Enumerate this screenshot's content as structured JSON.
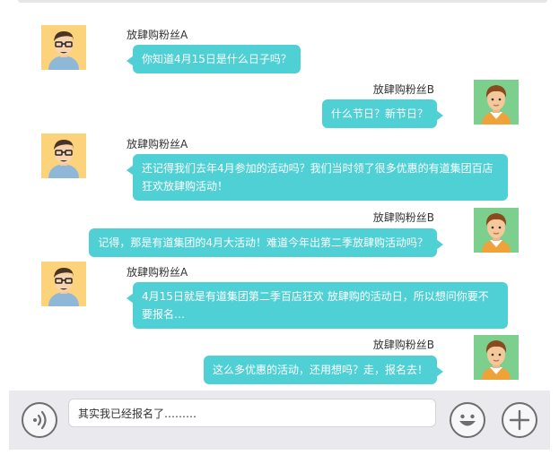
{
  "conversation": {
    "messages": [
      {
        "sender": "放肆购粉丝A",
        "text": "你知道4月15日是什么日子吗？"
      },
      {
        "sender": "放肆购粉丝B",
        "text": "什么节日？新节日？"
      },
      {
        "sender": "放肆购粉丝A",
        "text": "还记得我们去年4月参加的活动吗？我们当时领了很多优惠的有道集团百店狂欢放肆购活动！"
      },
      {
        "sender": "放肆购粉丝B",
        "text": "记得，那是有道集团的4月大活动！难道今年出第二季放肆购活动吗？"
      },
      {
        "sender": "放肆购粉丝A",
        "text": "4月15日就是有道集团第二季百店狂欢 放肆购的活动日，所以想问你要不要报名…"
      },
      {
        "sender": "放肆购粉丝B",
        "text": "这么多优惠的活动，还用想吗？走，报名去！"
      }
    ]
  },
  "composer": {
    "input_value": "其实我已经报名了………",
    "voice_icon": "voice-icon",
    "emoji_icon": "emoji-icon",
    "add_icon": "plus-icon"
  },
  "colors": {
    "bubble": "#4fd0d5",
    "avatar_a_bg": "#fcd27a",
    "avatar_b_bg": "#7ccf8c",
    "input_bar_bg": "#e9e9ee"
  }
}
